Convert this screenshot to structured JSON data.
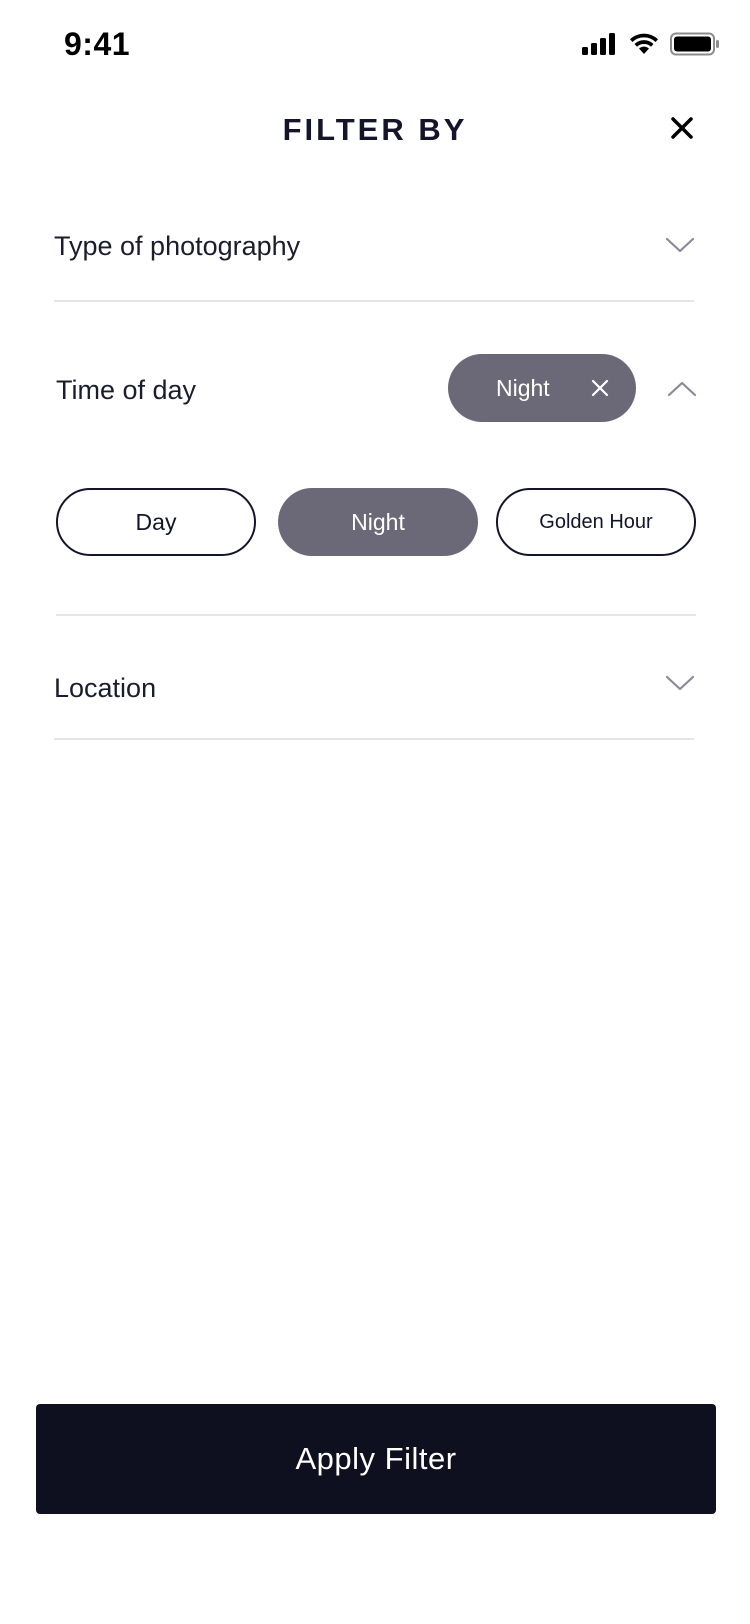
{
  "status_bar": {
    "time": "9:41"
  },
  "header": {
    "title": "FILTER BY"
  },
  "sections": {
    "type_of_photography": {
      "label": "Type of photography",
      "expanded": false
    },
    "time_of_day": {
      "label": "Time of day",
      "expanded": true,
      "selected_chip": "Night",
      "options": [
        {
          "label": "Day",
          "selected": false
        },
        {
          "label": "Night",
          "selected": true
        },
        {
          "label": "Golden Hour",
          "selected": false
        }
      ]
    },
    "location": {
      "label": "Location",
      "expanded": false
    }
  },
  "apply_button": {
    "label": "Apply Filter"
  },
  "colors": {
    "text_primary": "#14142b",
    "chip_fill": "#6b6977",
    "button_fill": "#0e0f1f",
    "divider": "#e5e5e8"
  },
  "icons": [
    "signal-icon",
    "wifi-icon",
    "battery-icon",
    "close-icon",
    "chevron-down-icon",
    "chevron-up-icon",
    "chip-remove-icon"
  ]
}
